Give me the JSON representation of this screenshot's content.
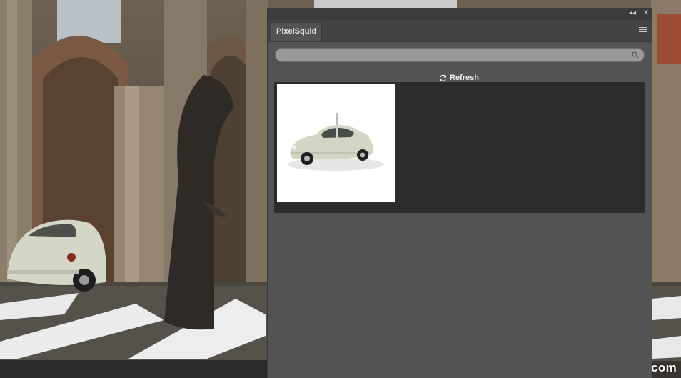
{
  "panel": {
    "tab_label": "PixelSquid",
    "collapse_glyph": "◂◂",
    "close_glyph": "✕",
    "search_placeholder": "",
    "refresh_label": "Refresh",
    "results": [
      {
        "name": "vw-beetle",
        "color": "#d9dccb"
      }
    ]
  },
  "icons": {
    "menu": "hamburger-icon",
    "search": "search-icon",
    "refresh": "refresh-icon"
  },
  "watermark": "pxleyes.com"
}
